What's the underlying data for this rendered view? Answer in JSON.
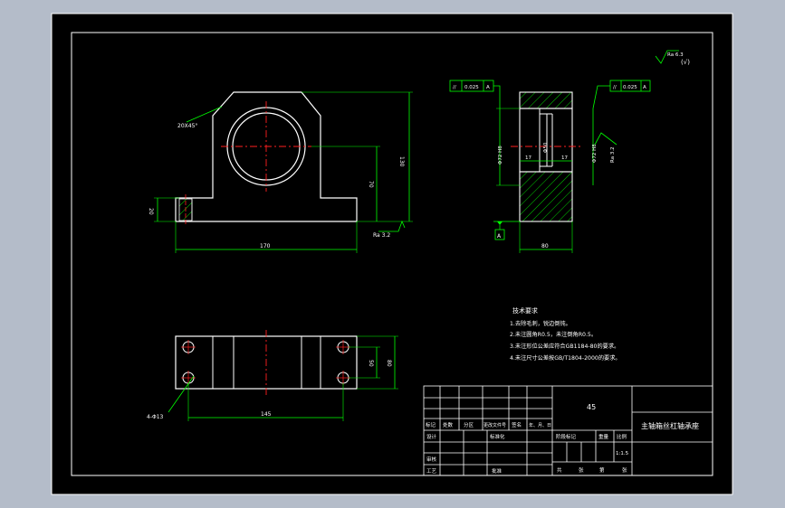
{
  "colors": {
    "viewport_bg": "#b4bcc9",
    "paper": "#000000",
    "frame": "#ffffff",
    "outline": "#ffffff",
    "dimension": "#00ff00",
    "centerline": "#ff2020",
    "hatch": "#00ff00",
    "text": "#ffffff"
  },
  "front_view": {
    "chamfer_note": "20X45°",
    "dim_height_total": "130",
    "dim_center_height": "70",
    "dim_base_height": "20",
    "dim_length": "170",
    "roughness": "Ra 3.2"
  },
  "side_view": {
    "tolerance_left": [
      "//",
      "0.025",
      "A"
    ],
    "tolerance_right": [
      "//",
      "0.025",
      "A"
    ],
    "dim_bore_left": "Φ72 H8",
    "dim_bore_right": "Φ72 H8",
    "dim_step_left": "17",
    "dim_step_right": "17",
    "dim_center": "Φ50",
    "dim_width": "80",
    "datum": "A",
    "roughness": "Ra 3.2"
  },
  "surface_symbol": {
    "value": "Ra 6.3",
    "extra": "(√)"
  },
  "top_view": {
    "hole_note": "4-Φ13",
    "dim_hole_spacing": "145",
    "dim_inner": "50",
    "dim_outer": "80"
  },
  "tech_requirements": {
    "title": "技术要求",
    "items": [
      "1.去除毛刺，锐边倒钝。",
      "2.未注圆角R0.5，未注倒角R0.5。",
      "3.未注形位公差应符合GB1184-80的要求。",
      "4.未注尺寸公差按GB/T1804-2000的要求。"
    ]
  },
  "title_block": {
    "material": "45",
    "part_name": "主轴箱丝杠轴承座",
    "row_labels": [
      "标记",
      "处数",
      "分区",
      "更改文件号",
      "签名",
      "年、月、日"
    ],
    "design_label": "设计",
    "standardize_label": "标准化",
    "stage_label": "阶段标记",
    "weight_label": "重量",
    "scale_label": "比例",
    "scale_value": "1:1.5",
    "review_label": "审核",
    "process_label": "工艺",
    "approve_label": "批准",
    "sheet_labels": [
      "共",
      "张",
      "第",
      "张"
    ]
  }
}
